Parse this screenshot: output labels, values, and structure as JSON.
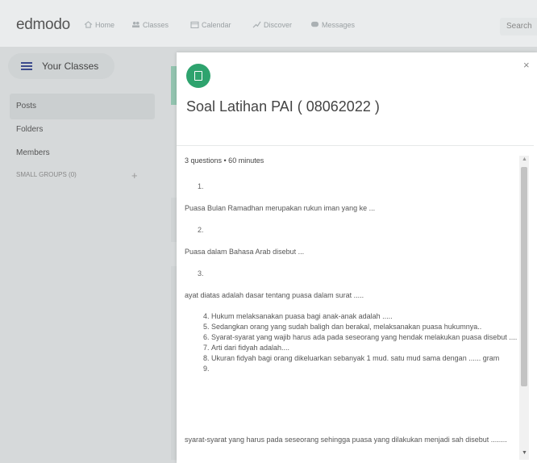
{
  "app": {
    "logo": "edmodo"
  },
  "nav": {
    "items": [
      {
        "label": "Home",
        "icon": "home-icon"
      },
      {
        "label": "Classes",
        "icon": "classes-icon"
      },
      {
        "label": "Calendar",
        "icon": "calendar-icon"
      },
      {
        "label": "Discover",
        "icon": "discover-icon"
      },
      {
        "label": "Messages",
        "icon": "messages-icon"
      }
    ],
    "search_label": "Search"
  },
  "sidebar": {
    "classes_button": "Your Classes",
    "items": [
      "Posts",
      "Folders",
      "Members"
    ],
    "small_groups": "SMALL GROUPS (0)",
    "add_symbol": "+"
  },
  "modal": {
    "title": "Soal Latihan PAI ( 08062022 )",
    "close_symbol": "×",
    "accent_color": "#2ea36e",
    "meta": "3 questions • 60 minutes",
    "questions": [
      {
        "number": "1.",
        "text": "Puasa Bulan Ramadhan merupakan rukun iman yang ke ..."
      },
      {
        "number": "2.",
        "text": "Puasa dalam Bahasa Arab disebut ..."
      },
      {
        "number": "3.",
        "text": "ayat diatas adalah dasar tentang puasa dalam surat ....."
      }
    ],
    "list_items": [
      "Hukum melaksanakan puasa bagi anak-anak adalah .....",
      "Sedangkan orang yang sudah baligh dan berakal, melaksanakan puasa hukumnya..",
      "Syarat-syarat yang wajib harus ada pada seseorang yang hendak melakukan puasa disebut ....",
      "Arti dari fidyah adalah....",
      "Ukuran fidyah bagi orang dikeluarkan sebanyak 1 mud. satu mud sama dengan ...... gram",
      ""
    ],
    "last_text": "syarat-syarat yang harus pada seseorang sehingga puasa yang dilakukan menjadi sah disebut ........"
  }
}
